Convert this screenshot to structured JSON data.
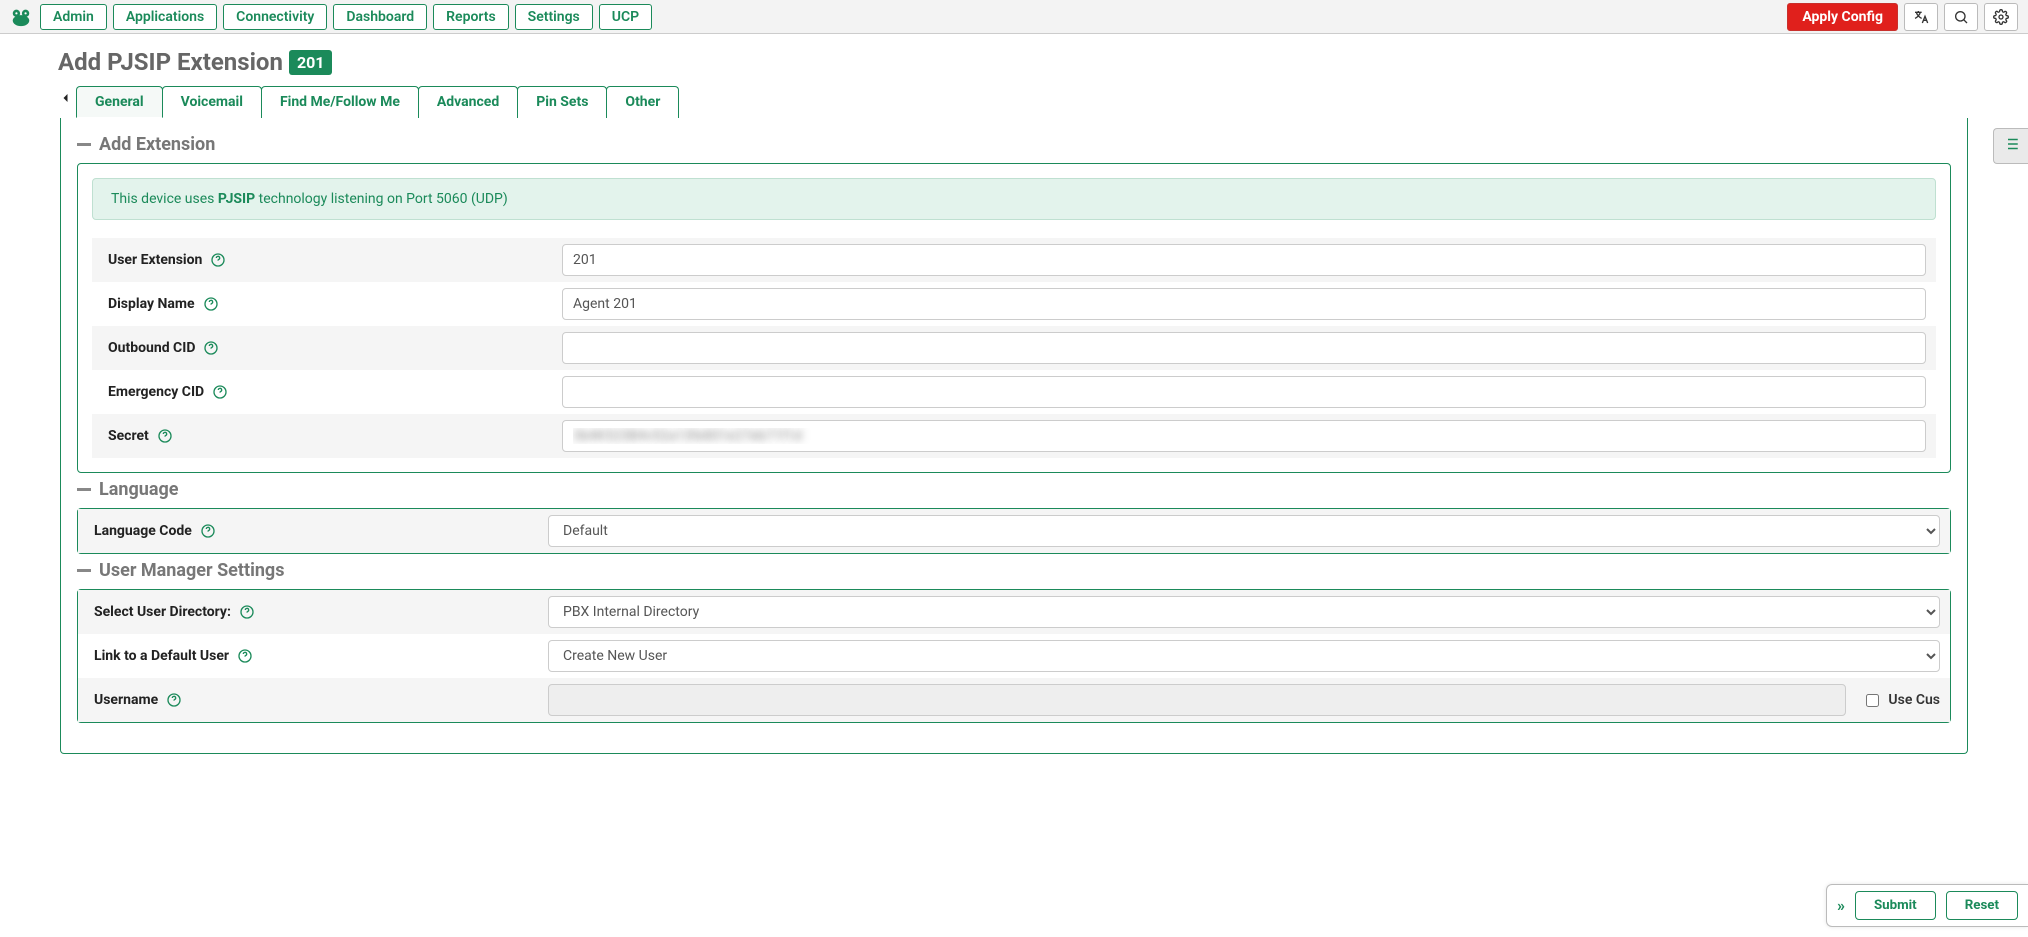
{
  "topnav": {
    "items": [
      "Admin",
      "Applications",
      "Connectivity",
      "Dashboard",
      "Reports",
      "Settings",
      "UCP"
    ],
    "apply_label": "Apply Config"
  },
  "page": {
    "title": "Add PJSIP Extension",
    "badge": "201"
  },
  "tabs": [
    "General",
    "Voicemail",
    "Find Me/Follow Me",
    "Advanced",
    "Pin Sets",
    "Other"
  ],
  "sections": {
    "add_extension": {
      "title": "Add Extension",
      "banner_pre": "This device uses ",
      "banner_tech": "PJSIP",
      "banner_post": " technology listening on Port 5060 (UDP)",
      "fields": {
        "user_extension": {
          "label": "User Extension",
          "value": "201"
        },
        "display_name": {
          "label": "Display Name",
          "value": "Agent 201"
        },
        "outbound_cid": {
          "label": "Outbound CID",
          "value": ""
        },
        "emergency_cid": {
          "label": "Emergency CID",
          "value": ""
        },
        "secret": {
          "label": "Secret",
          "value": "3b4K523B4v52a13fe801e27eb71f1d"
        }
      }
    },
    "language": {
      "title": "Language",
      "fields": {
        "language_code": {
          "label": "Language Code",
          "value": "Default"
        }
      }
    },
    "user_manager": {
      "title": "User Manager Settings",
      "fields": {
        "select_user_directory": {
          "label": "Select User Directory:",
          "value": "PBX Internal Directory"
        },
        "link_default_user": {
          "label": "Link to a Default User",
          "value": "Create New User"
        },
        "username": {
          "label": "Username",
          "value": "",
          "use_custom_label": "Use Cus"
        }
      }
    }
  },
  "bottom": {
    "submit": "Submit",
    "reset": "Reset"
  }
}
